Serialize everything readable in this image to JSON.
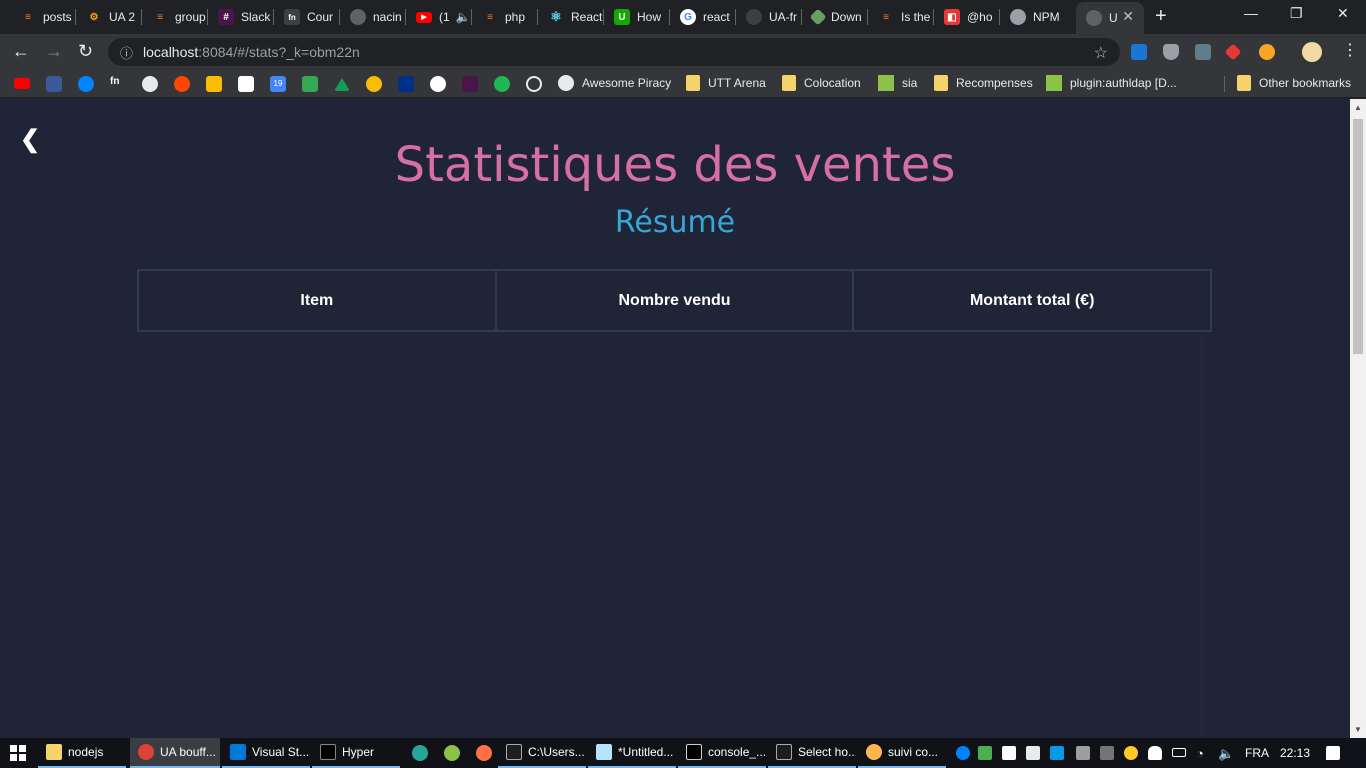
{
  "browser": {
    "tabs": [
      {
        "label": "posts",
        "icon": "stackoverflow-icon",
        "color": "#f48024"
      },
      {
        "label": "UA 2",
        "icon": "gear-icon",
        "color": "#f7a01c"
      },
      {
        "label": "group",
        "icon": "stackoverflow-icon",
        "color": "#f48024"
      },
      {
        "label": "Slack",
        "icon": "slack-icon",
        "color": "#4a154b"
      },
      {
        "label": "Cour",
        "icon": "fn-icon",
        "color": "#3c4043"
      },
      {
        "label": "nacin",
        "icon": "globe-icon",
        "color": "#5f6368"
      },
      {
        "label": "(1",
        "icon": "youtube-icon",
        "color": "#ff0000"
      },
      {
        "label": "php",
        "icon": "stackoverflow-icon",
        "color": "#f48024"
      },
      {
        "label": "React",
        "icon": "react-icon",
        "color": "#61dafb"
      },
      {
        "label": "How",
        "icon": "upwork-icon",
        "color": "#14a800"
      },
      {
        "label": "react",
        "icon": "google-icon",
        "color": "#4285f4"
      },
      {
        "label": "UA-fr",
        "icon": "github-icon",
        "color": "#3c4043"
      },
      {
        "label": "Down",
        "icon": "nodejs-icon",
        "color": "#68a063"
      },
      {
        "label": "Is the",
        "icon": "stackoverflow-icon",
        "color": "#f48024"
      },
      {
        "label": "@ho",
        "icon": "square-icon",
        "color": "#e53935"
      },
      {
        "label": "NPM",
        "icon": "npm-icon",
        "color": "#9aa0a6"
      },
      {
        "label": "U",
        "icon": "globe-icon",
        "color": "#5f6368"
      }
    ],
    "tab_close": "✕",
    "new_tab": "+",
    "window_controls": [
      "—",
      "❐",
      "✕"
    ],
    "url_host": "localhost",
    "url_path": ":8084/#/stats?_k=obm22n",
    "bookmark_icons": [
      "youtube-icon",
      "facebook-icon",
      "messenger-icon",
      "fn-icon",
      "github-icon",
      "reddit-icon",
      "keep-icon",
      "gmail-icon",
      "calendar-icon",
      "maps-icon",
      "drive-icon",
      "photos-icon",
      "paypal-icon",
      "ghost-icon",
      "slack-icon",
      "spotify-icon",
      "circle-icon"
    ],
    "bookmarks": [
      {
        "label": "Awesome Piracy",
        "icon": "github-icon"
      },
      {
        "label": "UTT Arena",
        "icon": "folder-icon"
      },
      {
        "label": "Colocation",
        "icon": "folder-icon"
      },
      {
        "label": "sia",
        "icon": "map-icon"
      },
      {
        "label": "Recompenses",
        "icon": "folder-icon"
      },
      {
        "label": "plugin:authldap [D...",
        "icon": "map-icon"
      }
    ],
    "other_bookmarks": "Other bookmarks",
    "calendar_day": "19"
  },
  "page": {
    "back": "❮",
    "title": "Statistiques des ventes",
    "subtitle": "Résumé",
    "columns": [
      "Item",
      "Nombre vendu",
      "Montant total (€)"
    ]
  },
  "taskbar": {
    "items": [
      {
        "label": "nodejs",
        "icon": "folder-icon"
      },
      {
        "label": "UA bouff...",
        "icon": "chrome-icon"
      },
      {
        "label": "Visual St...",
        "icon": "vscode-icon"
      },
      {
        "label": "Hyper",
        "icon": "terminal-icon"
      },
      {
        "label": "",
        "icon": "app-icon"
      },
      {
        "label": "",
        "icon": "hs-icon"
      },
      {
        "label": "",
        "icon": "app-icon"
      },
      {
        "label": "C:\\Users...",
        "icon": "cmd-icon"
      },
      {
        "label": "*Untitled...",
        "icon": "notepad-icon"
      },
      {
        "label": "console_...",
        "icon": "datagrip-icon"
      },
      {
        "label": "Select ho...",
        "icon": "cmd-icon"
      },
      {
        "label": "suivi co...",
        "icon": "paint-icon"
      }
    ],
    "language": "FRA",
    "time": "22:13"
  }
}
